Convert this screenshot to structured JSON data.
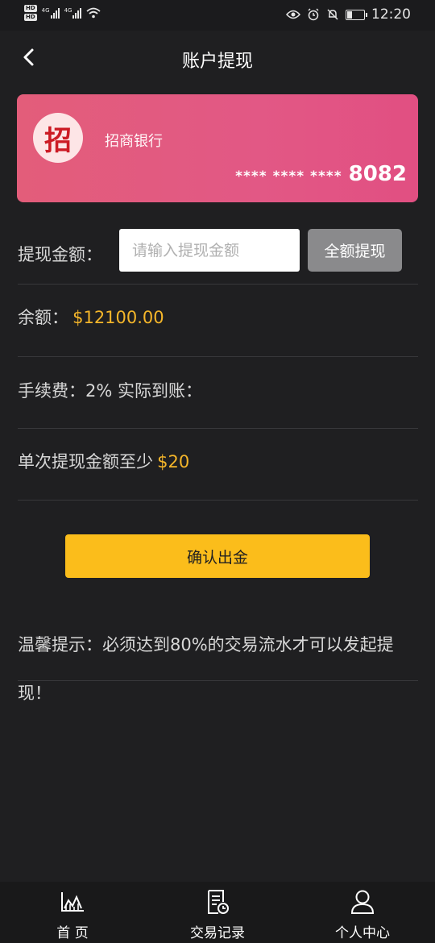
{
  "status_bar": {
    "network_1": "4G",
    "network_2": "4G",
    "time": "12:20",
    "icons": [
      "hd-icon",
      "signal-icon",
      "wifi-icon",
      "eye-icon",
      "alarm-icon",
      "mute-bell-icon",
      "battery-icon"
    ]
  },
  "header": {
    "title": "账户提现",
    "back_icon": "chevron-left-icon"
  },
  "card": {
    "logo_char": "招",
    "bank_name": "招商银行",
    "masked": "**** **** ****",
    "last4": "8082",
    "colors": {
      "from": "#e35d7a",
      "to": "#e14f82"
    }
  },
  "withdraw": {
    "label": "提现金额：",
    "input_value": "",
    "input_placeholder": "请输入提现金额",
    "full_button": "全额提现"
  },
  "balance": {
    "label": "余额：",
    "value": "$12100.00"
  },
  "fee": {
    "text": "手续费：2% 实际到账："
  },
  "minimum": {
    "text": "单次提现金额至少",
    "value": "$20"
  },
  "confirm_button": "确认出金",
  "tip": "温馨提示：必须达到80%的交易流水才可以发起提现！",
  "tabs": [
    {
      "label": "首 页",
      "icon": "chart-icon"
    },
    {
      "label": "交易记录",
      "icon": "record-icon"
    },
    {
      "label": "个人中心",
      "icon": "user-icon"
    }
  ],
  "colors": {
    "background": "#1f1f21",
    "accent": "#fbbd1b",
    "highlight_text": "#f5b62a"
  }
}
